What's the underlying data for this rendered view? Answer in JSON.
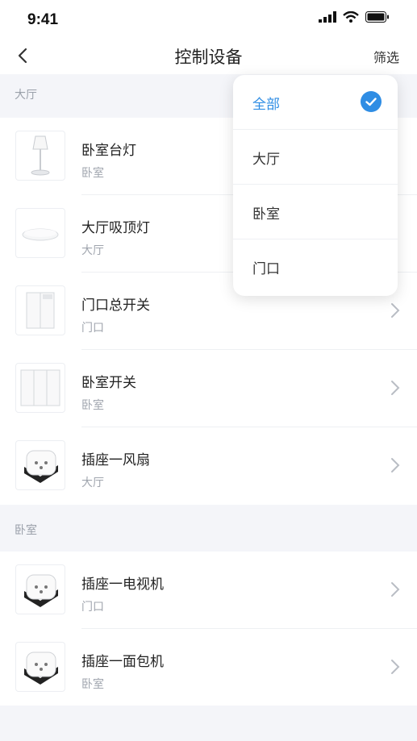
{
  "status": {
    "time": "9:41"
  },
  "nav": {
    "title": "控制设备",
    "filter_label": "筛选"
  },
  "sections": [
    {
      "title": "大厅",
      "devices": [
        {
          "name": "卧室台灯",
          "room": "卧室",
          "icon": "lamp-icon"
        },
        {
          "name": "大厅吸顶灯",
          "room": "大厅",
          "icon": "ceiling-light-icon"
        },
        {
          "name": "门口总开关",
          "room": "门口",
          "icon": "switch-icon"
        },
        {
          "name": "卧室开关",
          "room": "卧室",
          "icon": "triple-switch-icon"
        },
        {
          "name": "插座一风扇",
          "room": "大厅",
          "icon": "smart-plug-icon"
        }
      ]
    },
    {
      "title": "卧室",
      "devices": [
        {
          "name": "插座一电视机",
          "room": "门口",
          "icon": "smart-plug-icon"
        },
        {
          "name": "插座一面包机",
          "room": "卧室",
          "icon": "smart-plug-icon"
        }
      ]
    }
  ],
  "filter_menu": {
    "options": [
      "全部",
      "大厅",
      "卧室",
      "门口"
    ],
    "selected": "全部"
  },
  "colors": {
    "accent": "#2f8de4",
    "background": "#f4f5f9"
  }
}
